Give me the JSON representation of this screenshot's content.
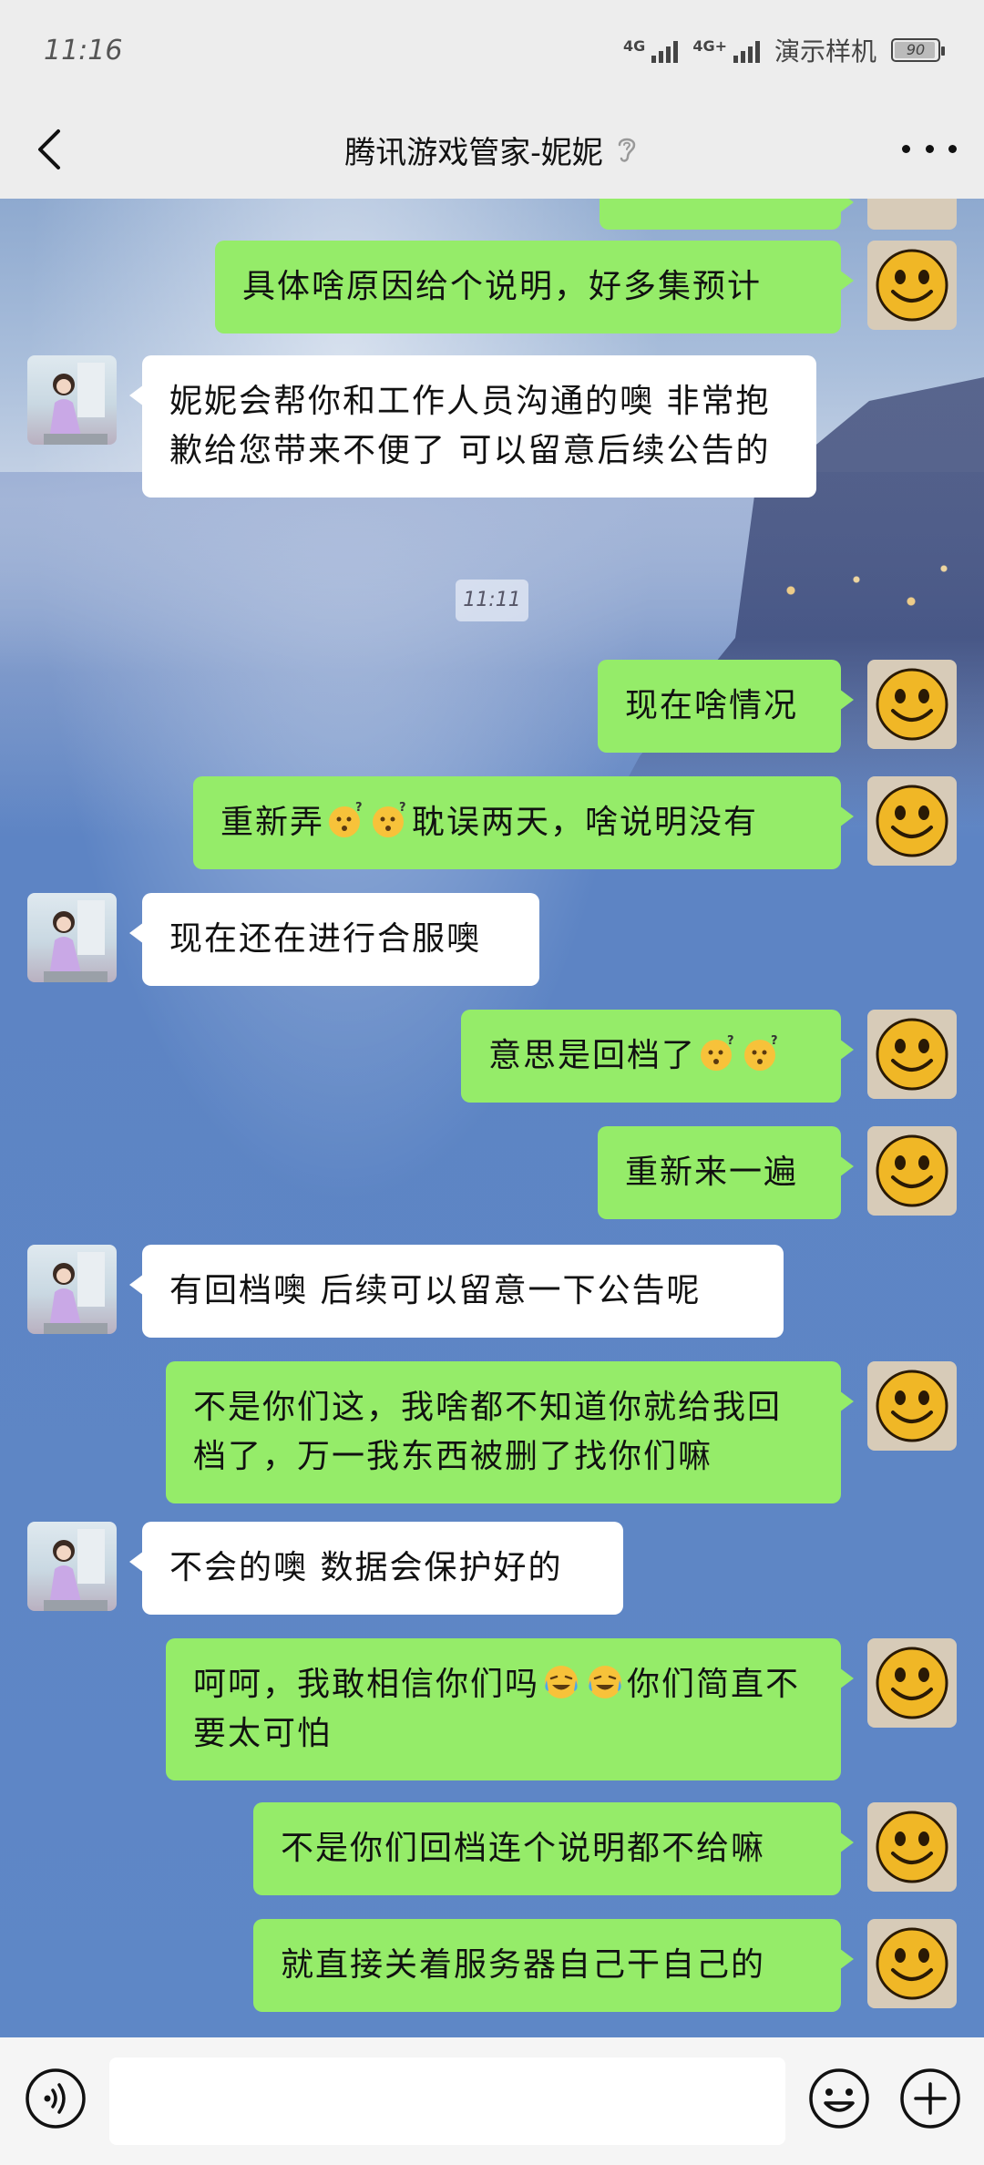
{
  "status_bar": {
    "time": "11:16",
    "network_1": "4G",
    "network_2": "4G+",
    "carrier_label": "演示样机",
    "battery": "90"
  },
  "header": {
    "title": "腾讯游戏管家-妮妮"
  },
  "chat": {
    "timestamp": "11:11",
    "messages": [
      {
        "side": "out",
        "text": "具体啥原因给个说明，好多集预计"
      },
      {
        "side": "in",
        "text": "妮妮会帮你和工作人员沟通的噢 非常抱歉给您带来不便了 可以留意后续公告的"
      },
      {
        "side": "out",
        "text": "现在啥情况"
      },
      {
        "side": "out",
        "text_before": "重新弄",
        "text_after": "耽误两天，啥说明没有",
        "emoji": "thinking-question-face"
      },
      {
        "side": "in",
        "text": "现在还在进行合服噢"
      },
      {
        "side": "out",
        "text": "意思是回档了",
        "emoji": "thinking-question-face"
      },
      {
        "side": "out",
        "text": "重新来一遍"
      },
      {
        "side": "in",
        "text": "有回档噢 后续可以留意一下公告呢"
      },
      {
        "side": "out",
        "text": "不是你们这，我啥都不知道你就给我回档了，万一我东西被删了找你们嘛"
      },
      {
        "side": "in",
        "text": "不会的噢 数据会保护好的"
      },
      {
        "side": "out",
        "text_before": "呵呵，我敢相信你们吗",
        "text_after": "你们简直不要太可怕",
        "emoji": "crying-laughing-face"
      },
      {
        "side": "out",
        "text": "不是你们回档连个说明都不给嘛"
      },
      {
        "side": "out",
        "text": "就直接关着服务器自己干自己的"
      }
    ]
  },
  "input_bar": {
    "placeholder": ""
  }
}
